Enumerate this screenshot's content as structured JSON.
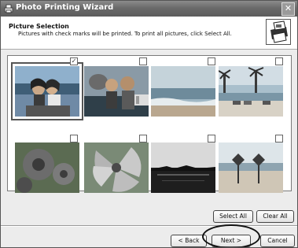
{
  "window": {
    "title": "Photo Printing Wizard"
  },
  "header": {
    "title": "Picture Selection",
    "subtitle": "Pictures with check marks will be printed.  To print all pictures, click Select All."
  },
  "photos": [
    {
      "checked": true,
      "check_glyph": "✓"
    },
    {
      "checked": false,
      "check_glyph": ""
    },
    {
      "checked": false,
      "check_glyph": ""
    },
    {
      "checked": false,
      "check_glyph": ""
    },
    {
      "checked": false,
      "check_glyph": ""
    },
    {
      "checked": false,
      "check_glyph": ""
    },
    {
      "checked": false,
      "check_glyph": ""
    },
    {
      "checked": false,
      "check_glyph": ""
    }
  ],
  "buttons": {
    "select_all": "Select All",
    "clear_all": "Clear All",
    "back": "< Back",
    "next": "Next >",
    "cancel": "Cancel"
  },
  "close_glyph": "✕"
}
